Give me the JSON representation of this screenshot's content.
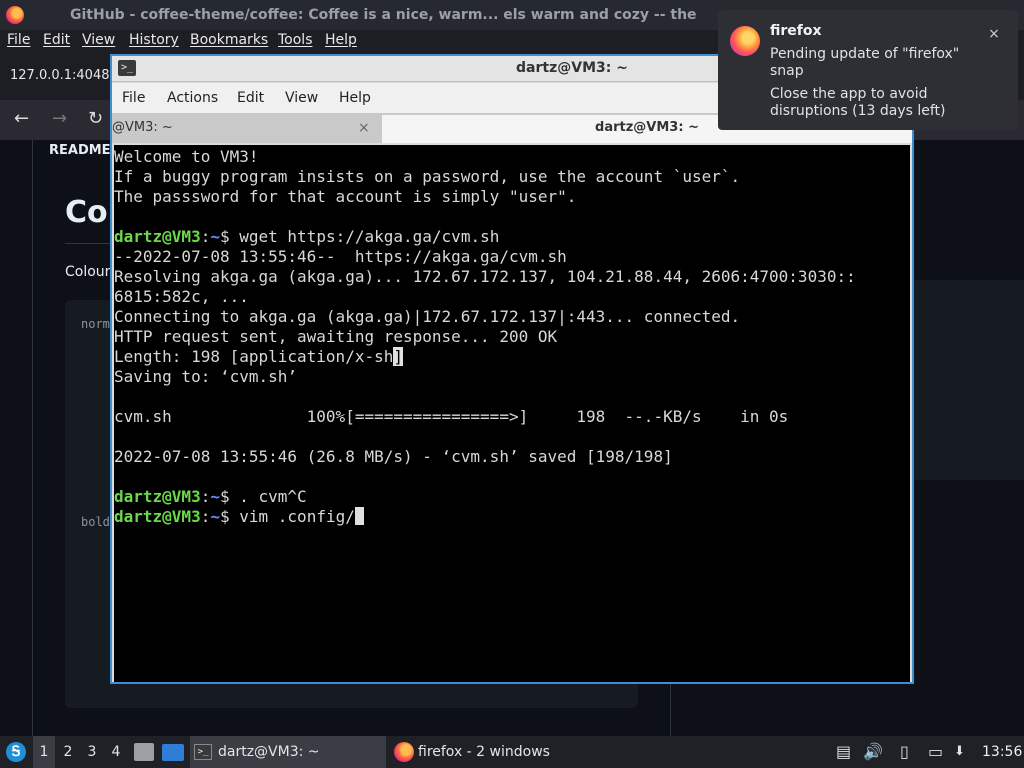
{
  "firefox": {
    "title": "GitHub - coffee-theme/coffee: Coffee is a nice, warm... els warm and cozy -- the",
    "menu": [
      "File",
      "Edit",
      "View",
      "History",
      "Bookmarks",
      "Tools",
      "Help"
    ],
    "url_partial": "127.0.0.1:4048",
    "page": {
      "readme_tab": "README",
      "heading": "Co",
      "colours_text": "Colour",
      "code_normal": "norm",
      "code_bold": "bold"
    }
  },
  "terminal": {
    "title": "dartz@VM3: ~",
    "menu": [
      "File",
      "Actions",
      "Edit",
      "View",
      "Help"
    ],
    "tabs": [
      {
        "label": "@VM3: ~",
        "close": "×"
      },
      {
        "label": "dartz@VM3: ~"
      }
    ],
    "icon_glyph": ">_",
    "prompt_user": "dartz@VM3",
    "prompt_colon": ":",
    "prompt_path": "~",
    "prompt_sign": "$",
    "lines": {
      "l1": "Welcome to VM3!",
      "l2": "If a buggy program insists on a password, use the account `user`.",
      "l3": "The passsword for that account is simply \"user\".",
      "cmd1": " wget https://akga.ga/cvm.sh",
      "l5": "--2022-07-08 13:55:46--  https://akga.ga/cvm.sh",
      "l6": "Resolving akga.ga (akga.ga)... 172.67.172.137, 104.21.88.44, 2606:4700:3030::",
      "l7": "6815:582c, ...",
      "l8": "Connecting to akga.ga (akga.ga)|172.67.172.137|:443... connected.",
      "l9": "HTTP request sent, awaiting response... 200 OK",
      "l10a": "Length: 198 [application/x-sh",
      "l10b": "]",
      "l11": "Saving to: ‘cvm.sh’",
      "l13": "cvm.sh              100%[================>]     198  --.-KB/s    in 0s",
      "l15": "2022-07-08 13:55:46 (26.8 MB/s) - ‘cvm.sh’ saved [198/198]",
      "cmd2": " . cvm^C",
      "cmd3": " vim .config/"
    }
  },
  "notification": {
    "app": "firefox",
    "line1": "Pending update of \"firefox\" snap",
    "line2": "Close the app to avoid disruptions (13 days left)",
    "close": "×"
  },
  "taskbar": {
    "start_glyph": "Ꭶ",
    "workspaces": [
      "1",
      "2",
      "3",
      "4"
    ],
    "active_workspace": "1",
    "tasks": {
      "terminal": "dartz@VM3: ~",
      "firefox": "firefox - 2 windows"
    },
    "clock": "13:56"
  },
  "colors": {
    "prompt_user": "#6bd94a",
    "prompt_path": "#6b8bff",
    "terminal_border": "#3d8fd1"
  }
}
